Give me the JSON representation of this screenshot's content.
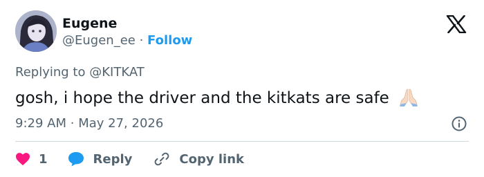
{
  "user": {
    "name": "Eugene",
    "handle": "@Eugen_ee",
    "separator": "·",
    "follow_label": "Follow"
  },
  "reply": {
    "prefix": "Replying to",
    "to": "@KITKAT"
  },
  "tweet": {
    "text": "gosh, i hope the driver and the kitkats are safe",
    "emoji": "🙏🏻"
  },
  "meta": {
    "time": "9:29 AM",
    "separator": "·",
    "date": "May 27, 2026"
  },
  "actions": {
    "like_count": "1",
    "reply_label": "Reply",
    "copy_label": "Copy link"
  },
  "colors": {
    "accent": "#1d9bf0",
    "like": "#f91880",
    "muted": "#536471",
    "text": "#0f1419"
  },
  "icons": [
    "x-logo-icon",
    "info-icon",
    "heart-icon",
    "reply-bubble-icon",
    "link-icon"
  ]
}
